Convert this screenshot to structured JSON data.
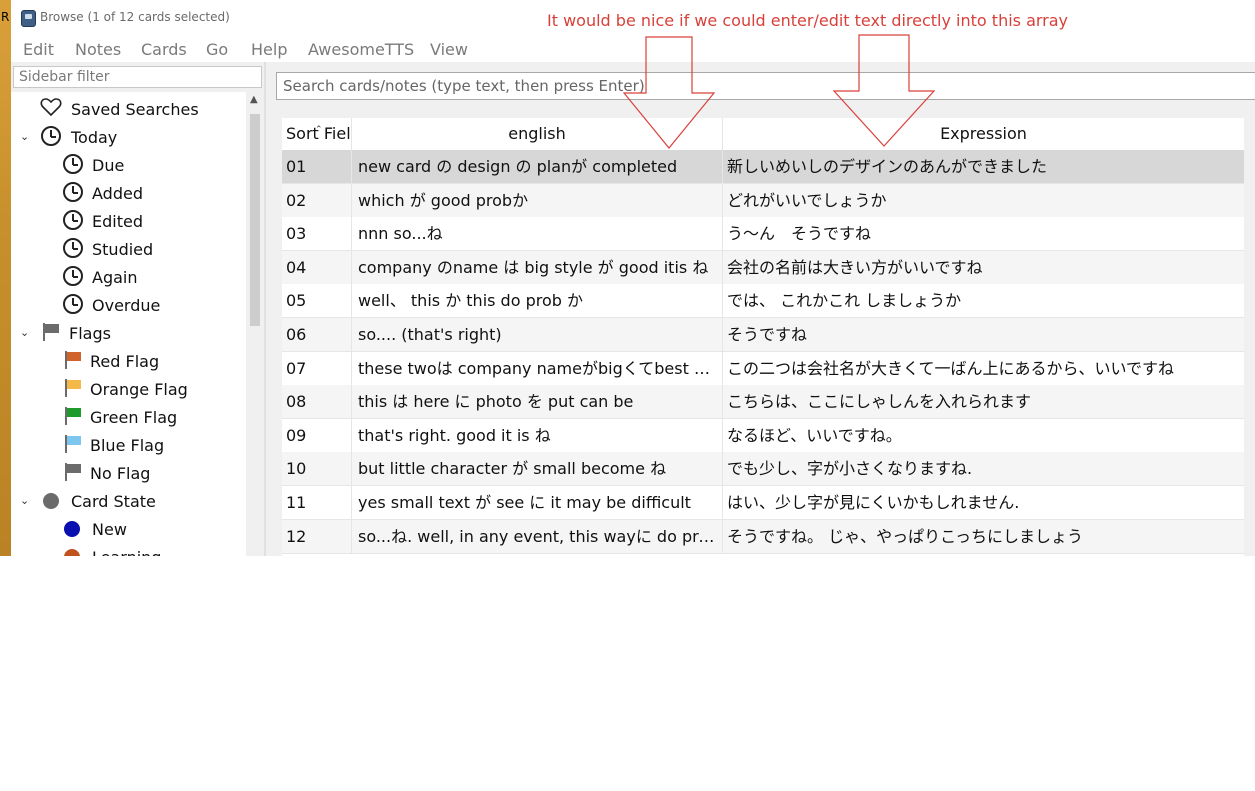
{
  "window": {
    "title": "Browse (1 of 12 cards selected)",
    "desktop_fragment": "R"
  },
  "menu": [
    "Edit",
    "Notes",
    "Cards",
    "Go",
    "Help",
    "AwesomeTTS",
    "View"
  ],
  "sidebar": {
    "filter_placeholder": "Sidebar filter",
    "items": [
      {
        "label": "Saved Searches",
        "icon": "heart-icon"
      },
      {
        "label": "Today",
        "icon": "clock-icon",
        "expanded": true
      },
      {
        "label": "Due",
        "icon": "clock-icon"
      },
      {
        "label": "Added",
        "icon": "clock-icon"
      },
      {
        "label": "Edited",
        "icon": "clock-icon"
      },
      {
        "label": "Studied",
        "icon": "clock-icon"
      },
      {
        "label": "Again",
        "icon": "clock-icon"
      },
      {
        "label": "Overdue",
        "icon": "clock-icon"
      },
      {
        "label": "Flags",
        "icon": "flag-icon",
        "color": "#6b6b6b",
        "expanded": true
      },
      {
        "label": "Red Flag",
        "icon": "flag-icon",
        "color": "#d0632b"
      },
      {
        "label": "Orange Flag",
        "icon": "flag-icon",
        "color": "#f5b94a"
      },
      {
        "label": "Green Flag",
        "icon": "flag-icon",
        "color": "#1f9b2c"
      },
      {
        "label": "Blue Flag",
        "icon": "flag-icon",
        "color": "#7dc6f0"
      },
      {
        "label": "No Flag",
        "icon": "flag-icon",
        "color": "#6b6b6b"
      },
      {
        "label": "Card State",
        "icon": "dot-icon",
        "color": "#6b6b6b",
        "expanded": true
      },
      {
        "label": "New",
        "icon": "dot-icon",
        "color": "#0a0fb0"
      },
      {
        "label": "Learning",
        "icon": "dot-icon",
        "color": "#c0521e"
      }
    ]
  },
  "search": {
    "placeholder": "Search cards/notes (type text, then press Enter)"
  },
  "table": {
    "columns": [
      "Sort Field",
      "english",
      "Expression"
    ],
    "sorted_column": "Sort Field",
    "selected_row": 0,
    "rows": [
      {
        "sort": "01",
        "english": "new card の design の planが completed",
        "expression": "新しいめいしのデザインのあんができました"
      },
      {
        "sort": "02",
        "english": "which が good probか",
        "expression": "どれがいいでしょうか"
      },
      {
        "sort": "03",
        "english": "nnn so...ね",
        "expression": "う〜ん　そうですね"
      },
      {
        "sort": "04",
        "english": "company のname は big style が good itis ね",
        "expression": "会社の名前は大きい方がいいですね"
      },
      {
        "sort": "05",
        "english": "well、 this か this do prob か",
        "expression": "では、 これかこれ しましょうか"
      },
      {
        "sort": "06",
        "english": "so.... (that's right)",
        "expression": "そうですね"
      },
      {
        "sort": "07",
        "english": "these twoは company nameがbigくてbest above",
        "expression": "この二つは会社名が大きくて一ばん上にあるから、いいですね"
      },
      {
        "sort": "08",
        "english": "this は here に photo を put can be",
        "expression": "こちらは、ここにしゃしんを入れられます"
      },
      {
        "sort": "09",
        "english": "that's right. good it is ね",
        "expression": "なるほど、いいですね。"
      },
      {
        "sort": "10",
        "english": "but little character が small become ね",
        "expression": "でも少し、字が小さくなりますね."
      },
      {
        "sort": "11",
        "english": "yes small text が see に it may be difficult",
        "expression": "はい、少し字が見にくいかもしれません."
      },
      {
        "sort": "12",
        "english": "so...ね. well, in any event, this wayに do prob",
        "expression": "そうですね。 じゃ、やっぱりこっちにしましょう"
      }
    ]
  },
  "annotation": {
    "text": "It would be nice if we could enter/edit text directly into this array",
    "color": "#d9403a"
  }
}
